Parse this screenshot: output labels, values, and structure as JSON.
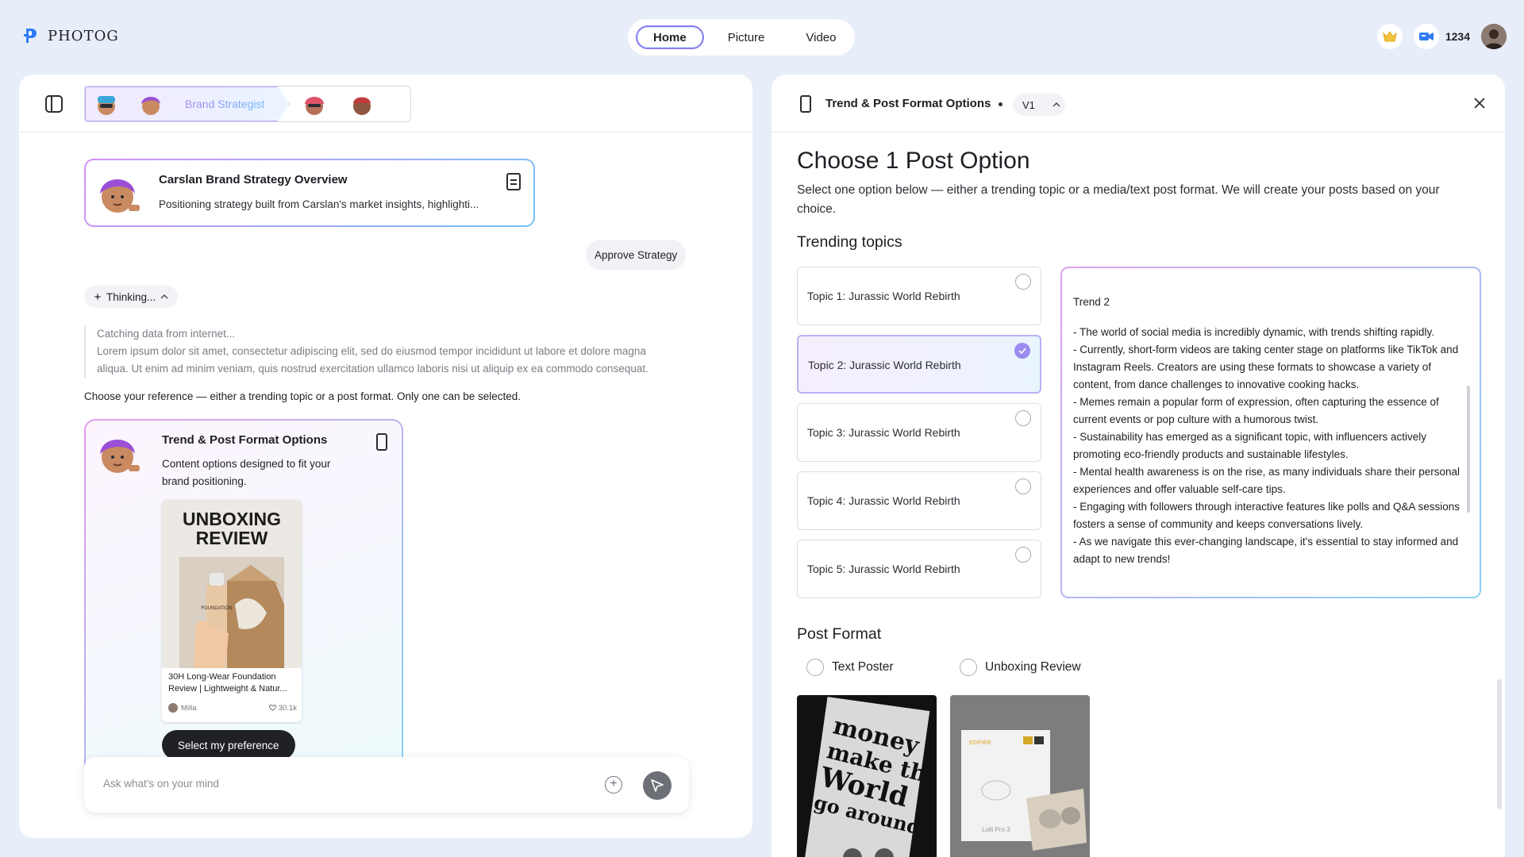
{
  "app": {
    "name": "PHOTOG"
  },
  "nav": {
    "tabs": [
      {
        "label": "Home"
      },
      {
        "label": "Picture"
      },
      {
        "label": "Video"
      }
    ]
  },
  "header_right": {
    "credits": "1234"
  },
  "left": {
    "agent_active_label": "Brand Strategist",
    "strategy_card": {
      "title": "Carslan Brand Strategy Overview",
      "subtitle": "Positioning strategy built from Carslan's market insights, highlighti..."
    },
    "approve_bubble": "Approve Strategy",
    "thinking_label": "Thinking...",
    "thinking_lines": [
      "Catching data from internet...",
      "Lorem ipsum dolor sit amet, consectetur adipiscing elit, sed do eiusmod tempor incididunt ut labore et dolore magna",
      "aliqua. Ut enim ad minim veniam, quis nostrud exercitation ullamco laboris nisi ut aliquip ex ea commodo consequat."
    ],
    "choose_reference": "Choose your reference — either a trending topic or a post format. Only one can be selected.",
    "trend_card": {
      "title": "Trend & Post Format Options",
      "description": "Content options designed to fit your brand positioning.",
      "preview": {
        "headline_line1": "UNBOXING",
        "headline_line2": "REVIEW",
        "bottle_text": "FOUNDATION",
        "caption": "30H Long-Wear Foundation Review | Lightweight & Natur...",
        "author": "Milla",
        "likes": "30.1k"
      },
      "button": "Select my preference"
    },
    "chat": {
      "placeholder": "Ask what's on your mind"
    }
  },
  "right": {
    "header": {
      "title": "Trend & Post Format Options",
      "version": "V1"
    },
    "title": "Choose 1 Post Option",
    "subtitle": "Select one option below — either a trending topic or a media/text post format. We will create your posts based on your choice.",
    "trending_heading": "Trending topics",
    "topics": [
      {
        "label": "Topic 1: Jurassic World Rebirth",
        "selected": false
      },
      {
        "label": "Topic 2: Jurassic World Rebirth",
        "selected": true
      },
      {
        "label": "Topic 3: Jurassic World Rebirth",
        "selected": false
      },
      {
        "label": "Topic 4: Jurassic World Rebirth",
        "selected": false
      },
      {
        "label": "Topic 5: Jurassic World Rebirth",
        "selected": false
      }
    ],
    "trend_detail": {
      "title": "Trend 2",
      "lines": [
        "- The world of social media is incredibly dynamic, with trends shifting rapidly.",
        "- Currently, short-form videos are taking center stage on platforms like TikTok and Instagram Reels. Creators are using these formats to showcase a variety of content, from dance challenges to innovative cooking hacks.",
        "- Memes remain a popular form of expression, often capturing the essence of current events or pop culture with a humorous twist.",
        "- Sustainability has emerged as a significant topic, with influencers actively promoting eco-friendly products and sustainable lifestyles.",
        "- Mental health awareness is on the rise, as many individuals share their personal experiences and offer valuable self-care tips.",
        "- Engaging with followers through interactive features like polls and Q&A sessions fosters a sense of community and keeps conversations lively.",
        "- As we navigate this ever-changing landscape, it's essential to stay informed and adapt to new trends!"
      ]
    },
    "post_format_heading": "Post Format",
    "post_formats": [
      {
        "label": "Text Poster"
      },
      {
        "label": "Unboxing Review"
      }
    ],
    "poster_text": [
      "money",
      "make the",
      "World",
      "go around"
    ],
    "box_brand": "EDIFIER",
    "box_model": "Lolli Pro 3"
  }
}
